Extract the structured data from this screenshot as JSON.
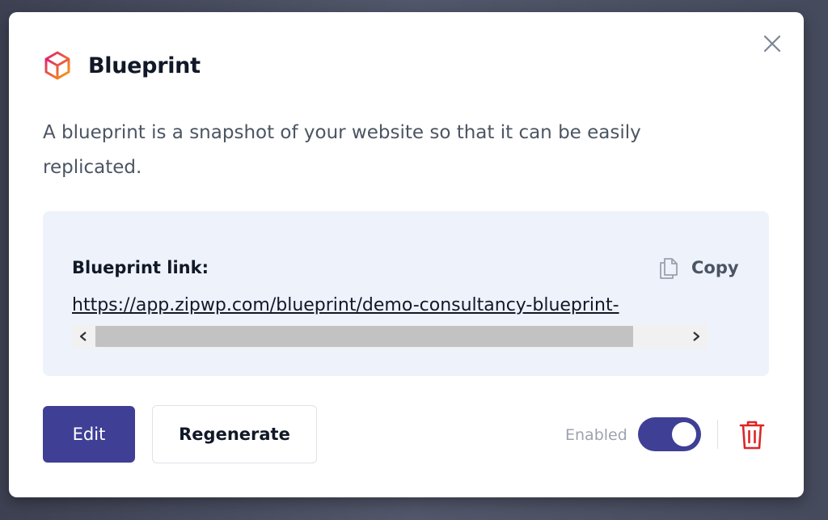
{
  "dialog": {
    "title": "Blueprint",
    "description": "A blueprint is a snapshot of your website so that it can be easily replicated.",
    "icon": "cube-icon",
    "close_icon": "close-icon"
  },
  "link_panel": {
    "label": "Blueprint link:",
    "copy_label": "Copy",
    "copy_icon": "copy-icon",
    "url": "https://app.zipwp.com/blueprint/demo-consultancy-blueprint-"
  },
  "actions": {
    "edit_label": "Edit",
    "regenerate_label": "Regenerate",
    "toggle_label": "Enabled",
    "toggle_enabled": true,
    "delete_icon": "trash-icon"
  },
  "colors": {
    "accent": "#3e3f95",
    "panel_bg": "#eef2fb",
    "danger": "#dc2626",
    "icon_gradient_start": "#e11d74",
    "icon_gradient_end": "#f59e0b"
  }
}
